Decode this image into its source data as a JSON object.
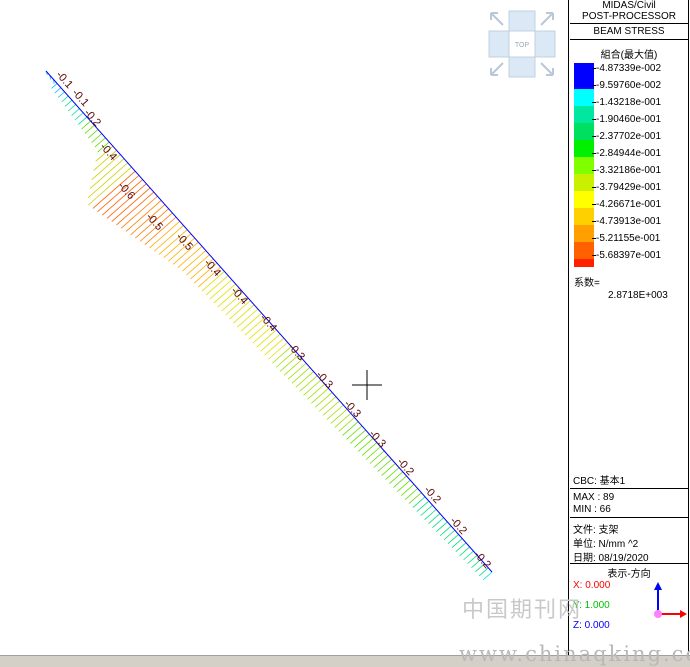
{
  "header": {
    "line1": "MIDAS/Civil",
    "line2": "POST-PROCESSOR",
    "line3": "BEAM STRESS",
    "combo_label": "組合(最大值)"
  },
  "legend": [
    {
      "label": "-4.87339e-002",
      "color": "#0000ff"
    },
    {
      "label": "-9.59760e-002",
      "color": "#00ffff"
    },
    {
      "label": "-1.43218e-001",
      "color": "#00e8a0"
    },
    {
      "label": "-1.90460e-001",
      "color": "#00e060"
    },
    {
      "label": "-2.37702e-001",
      "color": "#00f000"
    },
    {
      "label": "-2.84944e-001",
      "color": "#80ff00"
    },
    {
      "label": "-3.32186e-001",
      "color": "#c8f000"
    },
    {
      "label": "-3.79429e-001",
      "color": "#ffff00"
    },
    {
      "label": "-4.26671e-001",
      "color": "#ffd000"
    },
    {
      "label": "-4.73913e-001",
      "color": "#ffa000"
    },
    {
      "label": "-5.21155e-001",
      "color": "#ff6000"
    },
    {
      "label": "-5.68397e-001",
      "color": "#ff2000"
    }
  ],
  "factor": {
    "label": "系数=",
    "value": "2.8718E+003"
  },
  "cbc": "CBC: 基本1",
  "max": "MAX : 89",
  "min": "MIN : 66",
  "file": "文件: 支架",
  "unit": "单位: N/mm ^2",
  "date": "日期: 08/19/2020",
  "view_dir": "表示-方向",
  "coords": {
    "x": "X: 0.000",
    "y": "Y: 1.000",
    "z": "Z: 0.000"
  },
  "view_cube_label": "TOP",
  "watermark_cn": "中国期刊网",
  "watermark_url": "www.chinaqking.com",
  "stress_labels": [
    "-0.1",
    "-0.1",
    "-0.2",
    "-0.4",
    "-0.6",
    "-0.5",
    "-0.5",
    "-0.4",
    "-0.4",
    "-0.4",
    "-0.3",
    "-0.3",
    "-0.3",
    "-0.3",
    "-0.2",
    "-0.2",
    "-0.2",
    "-0.2"
  ],
  "colors": {
    "axis_x": "#ff0000",
    "axis_y": "#00c000",
    "axis_z": "#0000ff",
    "beam_line": "#0000ff",
    "label_text": "#5a0000"
  }
}
